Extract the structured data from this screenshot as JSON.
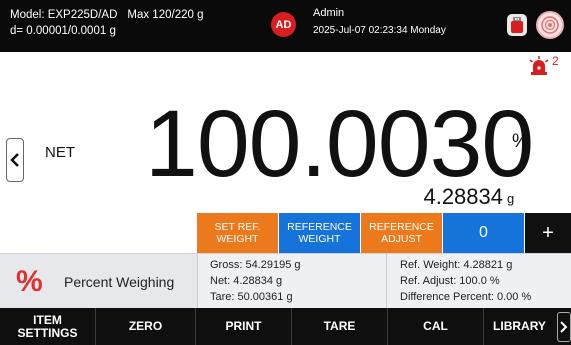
{
  "header": {
    "model_line": "Model: EXP225D/AD",
    "max_line": "Max 120/220 g",
    "resolution_line": "d= 0.00001/0.0001 g",
    "user_initials": "AD",
    "user_name": "Admin",
    "datetime": "2025-Jul-07 02:23:34 Monday",
    "usb_icon": "usb-drive-icon",
    "level_icon": "level-bubble-icon"
  },
  "display": {
    "alarm_count": "2",
    "alarm_icon": "alarm-light-icon",
    "mode_label": "NET",
    "value": "100.0030",
    "unit": "%",
    "ref_value": "4.28834",
    "ref_unit": "g"
  },
  "actions": [
    {
      "label": "SET REF.\nWEIGHT",
      "color": "#ec7a1c"
    },
    {
      "label": "REFERENCE\nWEIGHT",
      "color": "#1673d9"
    },
    {
      "label": "REFERENCE\nADJUST",
      "color": "#ec7a1c"
    },
    {
      "label": "0",
      "color": "#1673d9"
    },
    {
      "label": "+",
      "color": "#101010"
    }
  ],
  "info": {
    "mode_icon": "%",
    "mode_name": "Percent Weighing",
    "gross": "Gross: 54.29195 g",
    "net": "Net: 4.28834 g",
    "tare": "Tare: 50.00361 g",
    "ref_weight": "Ref. Weight: 4.28821 g",
    "ref_adjust": "Ref. Adjust: 100.0 %",
    "difference": "Difference Percent: 0.00 %"
  },
  "bottom": {
    "item_settings": "ITEM\nSETTINGS",
    "zero": "ZERO",
    "print": "PRINT",
    "tare": "TARE",
    "cal": "CAL",
    "library": "LIBRARY"
  },
  "colors": {
    "accent_orange": "#ec7a1c",
    "accent_blue": "#1673d9",
    "alert_red": "#d81e1e"
  }
}
